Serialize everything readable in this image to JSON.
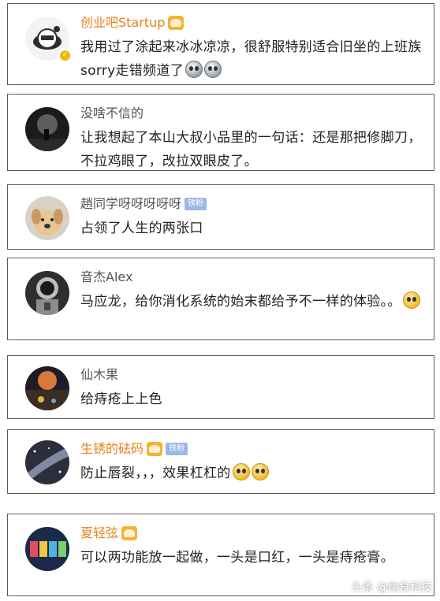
{
  "comments": [
    {
      "username": "创业吧Startup",
      "vip": true,
      "badge": "",
      "text": "我用过了涂起来冰冰凉凉，很舒服特别适合旧坐的上班族sorry走错频道了",
      "emojis": [
        "shocked-face-icon",
        "shocked-face-icon"
      ]
    },
    {
      "username": "没啥不信的",
      "vip": false,
      "badge": "",
      "text": "让我想起了本山大叔小品里的一句话：还是那把修脚刀，不拉鸡眼了，改拉双眼皮了。",
      "emojis": []
    },
    {
      "username": "趙同学呀呀呀呀呀",
      "vip": false,
      "badge": "铁粉",
      "text": "占领了人生的两张口",
      "emojis": []
    },
    {
      "username": "音杰Alex",
      "vip": false,
      "badge": "",
      "text": "马应龙，给你消化系统的始末都给予不一样的体验。。",
      "emojis": [
        "laugh-cry-face-icon"
      ]
    },
    {
      "username": "仙木果",
      "vip": false,
      "badge": "",
      "text": "给痔疮上上色",
      "emojis": []
    },
    {
      "username": "生锈的砝码",
      "vip": true,
      "badge": "铁粉",
      "text": "防止唇裂，，，效果杠杠的",
      "emojis": [
        "laugh-cry-face-icon",
        "grin-face-icon"
      ]
    },
    {
      "username": "夏轻弦",
      "vip": true,
      "badge": "",
      "text": "可以两功能放一起做，一头是口红，一头是痔疮膏。",
      "emojis": []
    }
  ],
  "watermark": "头条 @纳食科技",
  "colors": {
    "vip_name": "#e8831e",
    "normal_name": "#555555",
    "comment_text": "#222222",
    "card_border": "#5a5a5a",
    "fan_badge": "#9ab7ea"
  }
}
